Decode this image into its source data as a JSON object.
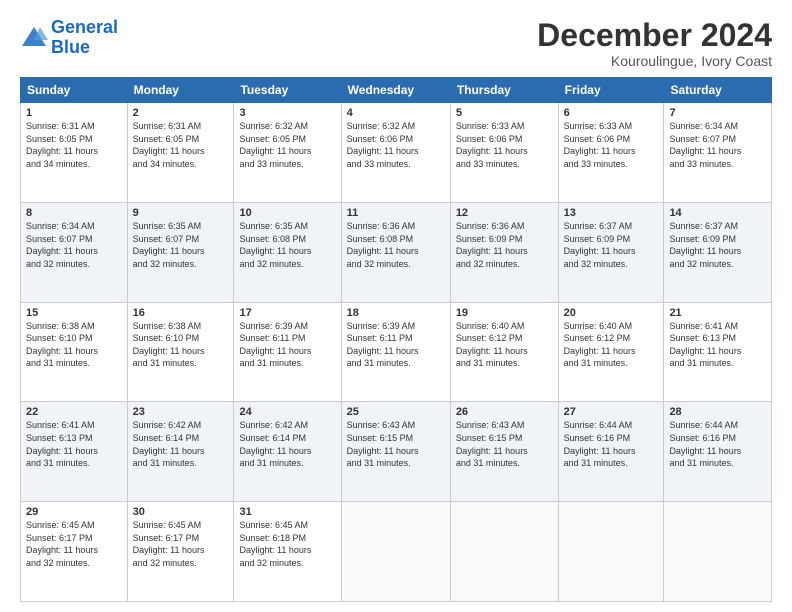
{
  "header": {
    "logo_line1": "General",
    "logo_line2": "Blue",
    "month": "December 2024",
    "location": "Kouroulingue, Ivory Coast"
  },
  "weekdays": [
    "Sunday",
    "Monday",
    "Tuesday",
    "Wednesday",
    "Thursday",
    "Friday",
    "Saturday"
  ],
  "weeks": [
    [
      {
        "day": "1",
        "info": "Sunrise: 6:31 AM\nSunset: 6:05 PM\nDaylight: 11 hours\nand 34 minutes."
      },
      {
        "day": "2",
        "info": "Sunrise: 6:31 AM\nSunset: 6:05 PM\nDaylight: 11 hours\nand 34 minutes."
      },
      {
        "day": "3",
        "info": "Sunrise: 6:32 AM\nSunset: 6:05 PM\nDaylight: 11 hours\nand 33 minutes."
      },
      {
        "day": "4",
        "info": "Sunrise: 6:32 AM\nSunset: 6:06 PM\nDaylight: 11 hours\nand 33 minutes."
      },
      {
        "day": "5",
        "info": "Sunrise: 6:33 AM\nSunset: 6:06 PM\nDaylight: 11 hours\nand 33 minutes."
      },
      {
        "day": "6",
        "info": "Sunrise: 6:33 AM\nSunset: 6:06 PM\nDaylight: 11 hours\nand 33 minutes."
      },
      {
        "day": "7",
        "info": "Sunrise: 6:34 AM\nSunset: 6:07 PM\nDaylight: 11 hours\nand 33 minutes."
      }
    ],
    [
      {
        "day": "8",
        "info": "Sunrise: 6:34 AM\nSunset: 6:07 PM\nDaylight: 11 hours\nand 32 minutes."
      },
      {
        "day": "9",
        "info": "Sunrise: 6:35 AM\nSunset: 6:07 PM\nDaylight: 11 hours\nand 32 minutes."
      },
      {
        "day": "10",
        "info": "Sunrise: 6:35 AM\nSunset: 6:08 PM\nDaylight: 11 hours\nand 32 minutes."
      },
      {
        "day": "11",
        "info": "Sunrise: 6:36 AM\nSunset: 6:08 PM\nDaylight: 11 hours\nand 32 minutes."
      },
      {
        "day": "12",
        "info": "Sunrise: 6:36 AM\nSunset: 6:09 PM\nDaylight: 11 hours\nand 32 minutes."
      },
      {
        "day": "13",
        "info": "Sunrise: 6:37 AM\nSunset: 6:09 PM\nDaylight: 11 hours\nand 32 minutes."
      },
      {
        "day": "14",
        "info": "Sunrise: 6:37 AM\nSunset: 6:09 PM\nDaylight: 11 hours\nand 32 minutes."
      }
    ],
    [
      {
        "day": "15",
        "info": "Sunrise: 6:38 AM\nSunset: 6:10 PM\nDaylight: 11 hours\nand 31 minutes."
      },
      {
        "day": "16",
        "info": "Sunrise: 6:38 AM\nSunset: 6:10 PM\nDaylight: 11 hours\nand 31 minutes."
      },
      {
        "day": "17",
        "info": "Sunrise: 6:39 AM\nSunset: 6:11 PM\nDaylight: 11 hours\nand 31 minutes."
      },
      {
        "day": "18",
        "info": "Sunrise: 6:39 AM\nSunset: 6:11 PM\nDaylight: 11 hours\nand 31 minutes."
      },
      {
        "day": "19",
        "info": "Sunrise: 6:40 AM\nSunset: 6:12 PM\nDaylight: 11 hours\nand 31 minutes."
      },
      {
        "day": "20",
        "info": "Sunrise: 6:40 AM\nSunset: 6:12 PM\nDaylight: 11 hours\nand 31 minutes."
      },
      {
        "day": "21",
        "info": "Sunrise: 6:41 AM\nSunset: 6:13 PM\nDaylight: 11 hours\nand 31 minutes."
      }
    ],
    [
      {
        "day": "22",
        "info": "Sunrise: 6:41 AM\nSunset: 6:13 PM\nDaylight: 11 hours\nand 31 minutes."
      },
      {
        "day": "23",
        "info": "Sunrise: 6:42 AM\nSunset: 6:14 PM\nDaylight: 11 hours\nand 31 minutes."
      },
      {
        "day": "24",
        "info": "Sunrise: 6:42 AM\nSunset: 6:14 PM\nDaylight: 11 hours\nand 31 minutes."
      },
      {
        "day": "25",
        "info": "Sunrise: 6:43 AM\nSunset: 6:15 PM\nDaylight: 11 hours\nand 31 minutes."
      },
      {
        "day": "26",
        "info": "Sunrise: 6:43 AM\nSunset: 6:15 PM\nDaylight: 11 hours\nand 31 minutes."
      },
      {
        "day": "27",
        "info": "Sunrise: 6:44 AM\nSunset: 6:16 PM\nDaylight: 11 hours\nand 31 minutes."
      },
      {
        "day": "28",
        "info": "Sunrise: 6:44 AM\nSunset: 6:16 PM\nDaylight: 11 hours\nand 31 minutes."
      }
    ],
    [
      {
        "day": "29",
        "info": "Sunrise: 6:45 AM\nSunset: 6:17 PM\nDaylight: 11 hours\nand 32 minutes."
      },
      {
        "day": "30",
        "info": "Sunrise: 6:45 AM\nSunset: 6:17 PM\nDaylight: 11 hours\nand 32 minutes."
      },
      {
        "day": "31",
        "info": "Sunrise: 6:45 AM\nSunset: 6:18 PM\nDaylight: 11 hours\nand 32 minutes."
      },
      {
        "day": "",
        "info": ""
      },
      {
        "day": "",
        "info": ""
      },
      {
        "day": "",
        "info": ""
      },
      {
        "day": "",
        "info": ""
      }
    ]
  ]
}
